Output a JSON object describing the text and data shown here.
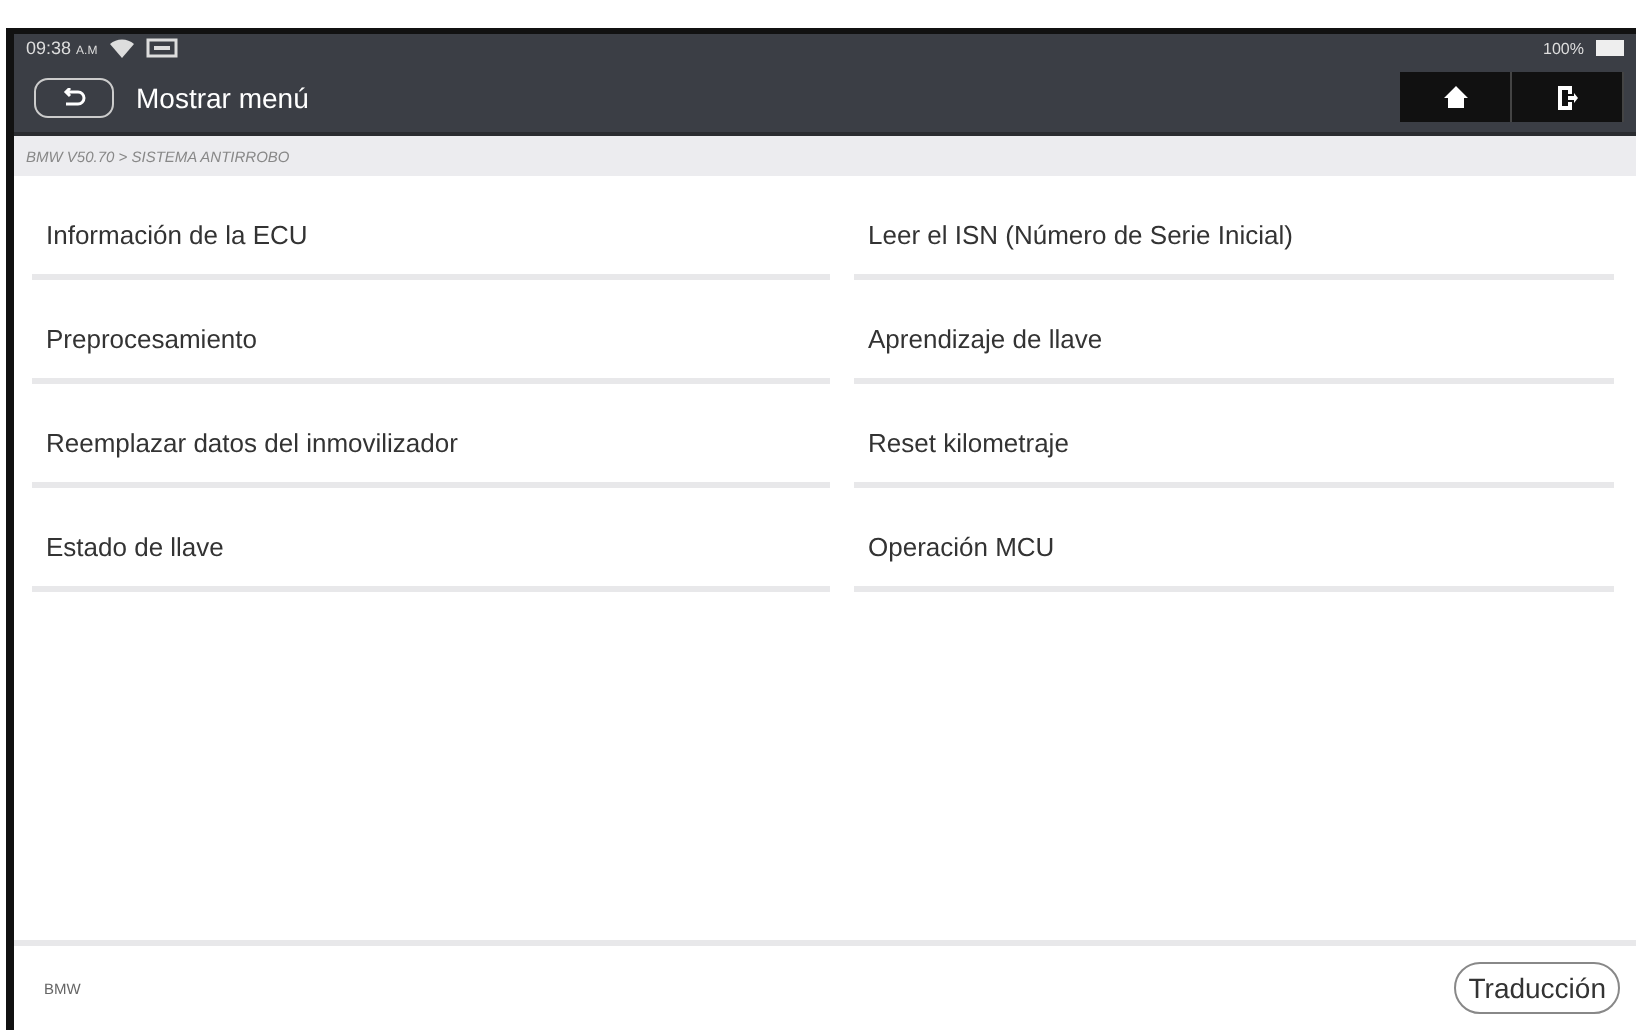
{
  "status_bar": {
    "time": "09:38",
    "ampm": "A.M",
    "battery": "100%"
  },
  "header": {
    "title": "Mostrar menú"
  },
  "breadcrumb": "BMW V50.70 > SISTEMA ANTIRROBO",
  "menu_items": [
    {
      "label": "Información de la ECU"
    },
    {
      "label": "Leer el ISN (Número de Serie Inicial)"
    },
    {
      "label": "Preprocesamiento"
    },
    {
      "label": "Aprendizaje de llave"
    },
    {
      "label": "Reemplazar datos del inmovilizador"
    },
    {
      "label": "Reset kilometraje"
    },
    {
      "label": "Estado de llave"
    },
    {
      "label": "Operación MCU"
    }
  ],
  "footer": {
    "label": "BMW",
    "button": "Traducción"
  }
}
